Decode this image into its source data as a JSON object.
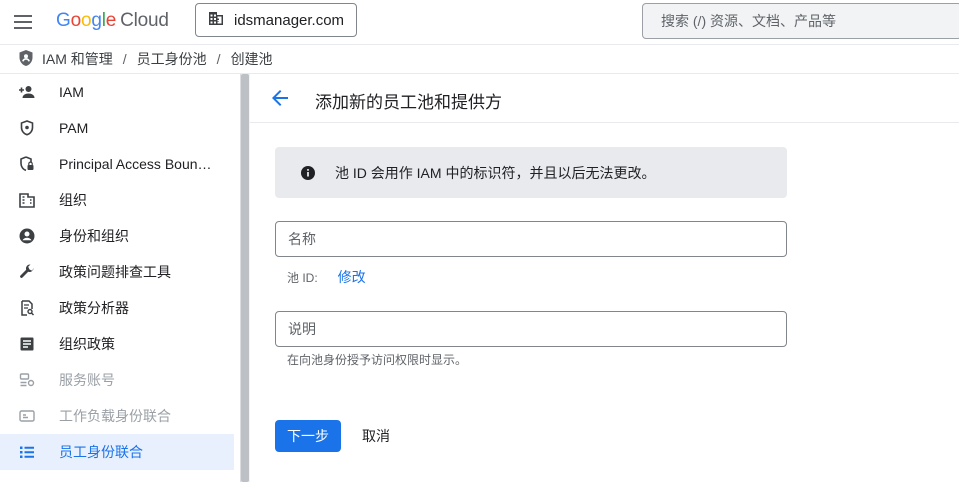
{
  "topbar": {
    "logo": {
      "g1": "G",
      "g2": "o",
      "g3": "o",
      "g4": "g",
      "g5": "l",
      "g6": "e",
      "product": "Cloud"
    },
    "project_name": "idsmanager.com",
    "search_placeholder": "搜索 (/) 资源、文档、产品等"
  },
  "breadcrumb": {
    "items": [
      "IAM 和管理",
      "员工身份池",
      "创建池"
    ],
    "separator": "/"
  },
  "sidebar": {
    "items": [
      {
        "label": "IAM",
        "icon": "person-add-icon",
        "state": "normal"
      },
      {
        "label": "PAM",
        "icon": "shield-icon",
        "state": "normal"
      },
      {
        "label": "Principal Access Boun…",
        "icon": "shield-lock-icon",
        "state": "normal"
      },
      {
        "label": "组织",
        "icon": "building-icon",
        "state": "normal"
      },
      {
        "label": "身份和组织",
        "icon": "account-circle-icon",
        "state": "normal"
      },
      {
        "label": "政策问题排查工具",
        "icon": "wrench-icon",
        "state": "normal"
      },
      {
        "label": "政策分析器",
        "icon": "document-search-icon",
        "state": "normal"
      },
      {
        "label": "组织政策",
        "icon": "article-icon",
        "state": "normal"
      },
      {
        "label": "服务账号",
        "icon": "service-account-icon",
        "state": "disabled"
      },
      {
        "label": "工作负载身份联合",
        "icon": "id-card-icon",
        "state": "disabled"
      },
      {
        "label": "员工身份联合",
        "icon": "list-icon",
        "state": "active"
      }
    ]
  },
  "main": {
    "title": "添加新的员工池和提供方",
    "info_text": "池 ID 会用作 IAM 中的标识符，并且以后无法更改。",
    "name_placeholder": "名称",
    "pool_id_label": "池 ID:",
    "pool_id_edit": "修改",
    "description_placeholder": "说明",
    "description_helper": "在向池身份授予访问权限时显示。",
    "next_button": "下一步",
    "cancel_button": "取消"
  },
  "colors": {
    "accent": "#1a73e8",
    "active_bg": "#e8f0fe",
    "info_bg": "#e8eaed"
  }
}
